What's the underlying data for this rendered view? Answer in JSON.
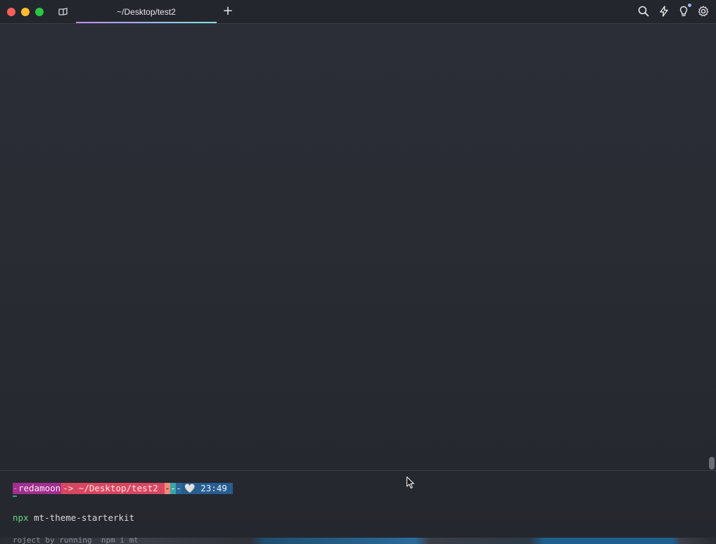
{
  "window": {
    "tab_title": "~/Desktop/test2",
    "new_tab_label": "+"
  },
  "toolbar": {
    "icons": [
      "search-icon",
      "lightning-icon",
      "lightbulb-icon",
      "gear-icon"
    ]
  },
  "prompt": {
    "lead": "-",
    "user": "redamoon",
    "path": "-> ~/Desktop/test2 ",
    "git_a": "-",
    "git_b": "-",
    "git_c": "-",
    "time": "🤍 23:49"
  },
  "command": {
    "bin": "npx",
    "args": " mt-theme-starterkit"
  },
  "footer_text": "roject by running  npm i mt",
  "colors": {
    "accent_gradient_start": "#c58af9",
    "accent_gradient_end": "#7fe3d6",
    "user_segment": "#a22f8f",
    "path_segment": "#d9465f",
    "time_segment": "#275d8f",
    "command_bin": "#5fd787"
  }
}
